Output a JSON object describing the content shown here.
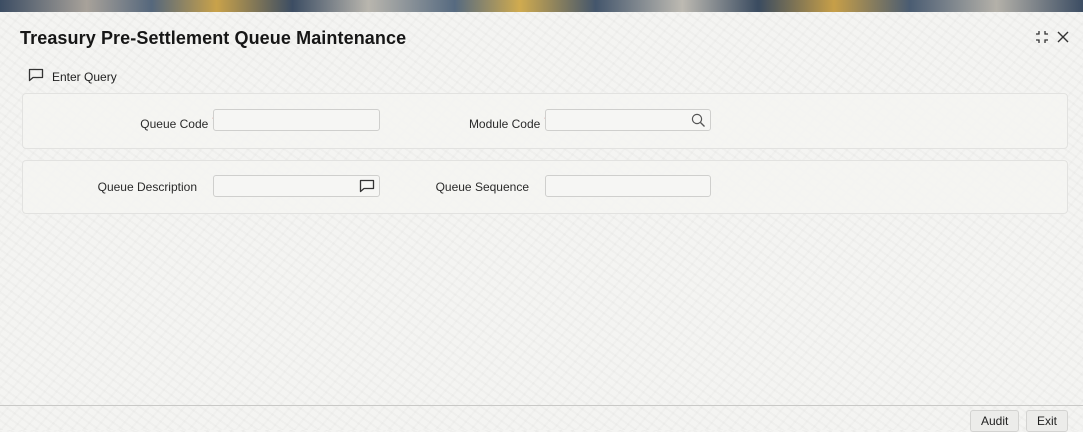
{
  "window": {
    "title": "Treasury Pre-Settlement Queue Maintenance",
    "expand_icon": "expand-arrows-icon",
    "close_icon": "close-icon"
  },
  "toolbar": {
    "enter_query_label": "Enter Query",
    "enter_query_icon": "speech-bubble-icon"
  },
  "form": {
    "queue_code": {
      "label": "Queue Code",
      "required": true,
      "required_marker": "*",
      "value": ""
    },
    "module_code": {
      "label": "Module Code",
      "required": true,
      "required_marker": "*",
      "value": "",
      "lookup_icon": "search-icon"
    },
    "queue_description": {
      "label": "Queue Description",
      "value": "",
      "edit_icon": "speech-bubble-icon"
    },
    "queue_sequence": {
      "label": "Queue Sequence",
      "value": ""
    }
  },
  "footer": {
    "audit_label": "Audit",
    "exit_label": "Exit"
  }
}
